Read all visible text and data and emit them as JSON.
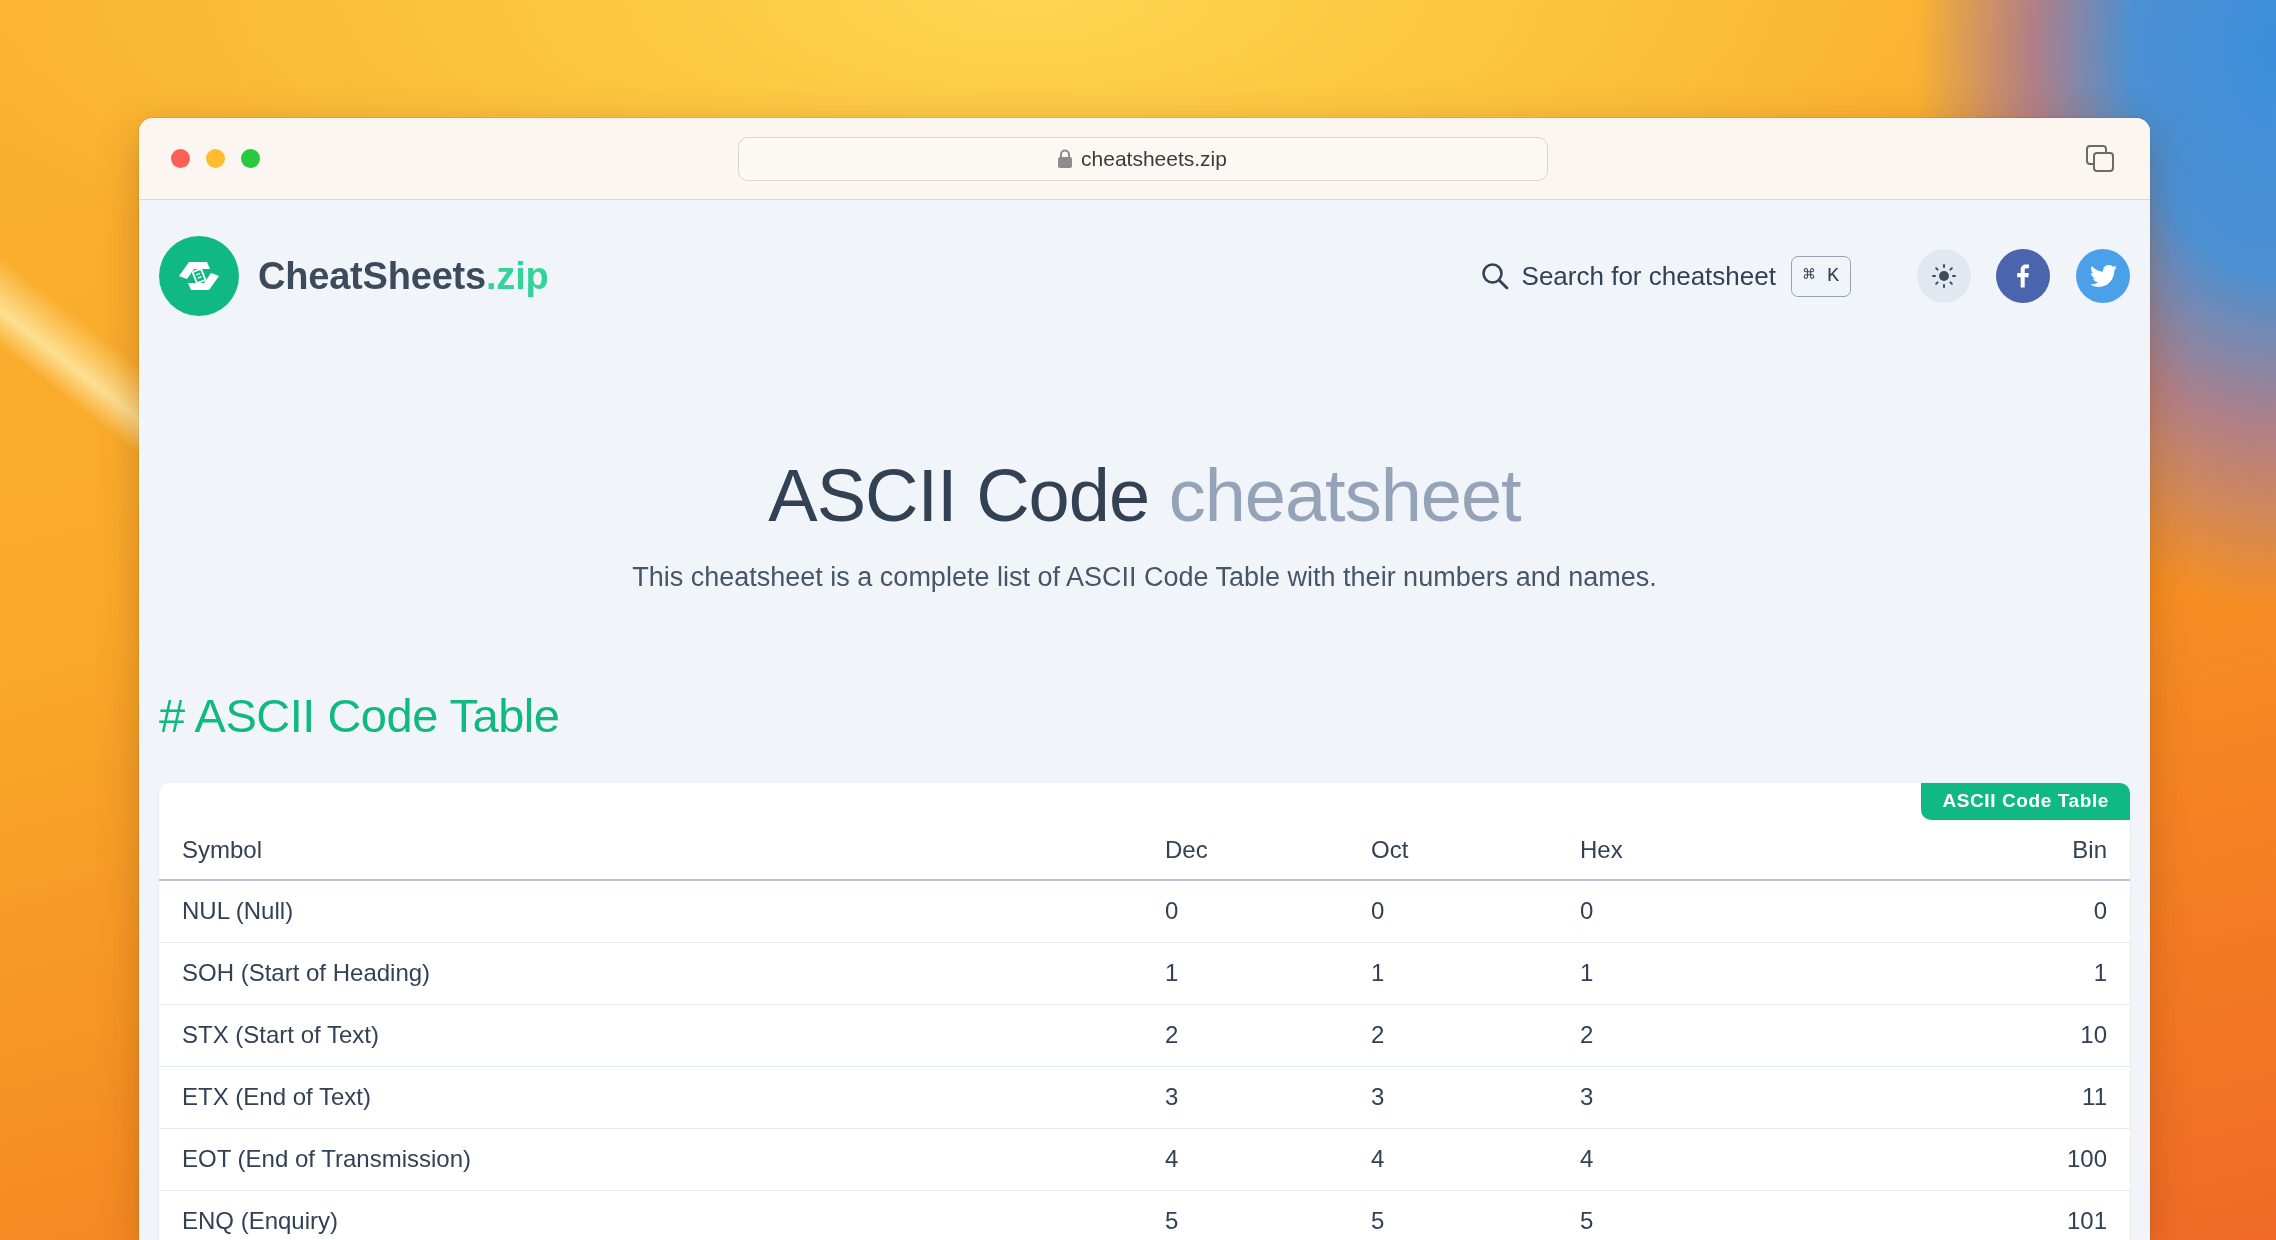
{
  "browser": {
    "url": "cheatsheets.zip"
  },
  "header": {
    "brand": {
      "name": "CheatSheets",
      "suffix": ".zip"
    },
    "search": {
      "label": "Search for cheatsheet",
      "shortcut": "⌘ K"
    }
  },
  "hero": {
    "title": "ASCII Code",
    "title_accent": "cheatsheet",
    "subtitle": "This cheatsheet is a complete list of ASCII Code Table with their numbers and names."
  },
  "section": {
    "heading": "# ASCII Code Table",
    "table": {
      "tag": "ASCII Code Table",
      "columns": [
        "Symbol",
        "Dec",
        "Oct",
        "Hex",
        "Bin"
      ],
      "rows": [
        [
          "NUL (Null)",
          "0",
          "0",
          "0",
          "0"
        ],
        [
          "SOH (Start of Heading)",
          "1",
          "1",
          "1",
          "1"
        ],
        [
          "STX (Start of Text)",
          "2",
          "2",
          "2",
          "10"
        ],
        [
          "ETX (End of Text)",
          "3",
          "3",
          "3",
          "11"
        ],
        [
          "EOT (End of Transmission)",
          "4",
          "4",
          "4",
          "100"
        ],
        [
          "ENQ (Enquiry)",
          "5",
          "5",
          "5",
          "101"
        ]
      ]
    }
  }
}
